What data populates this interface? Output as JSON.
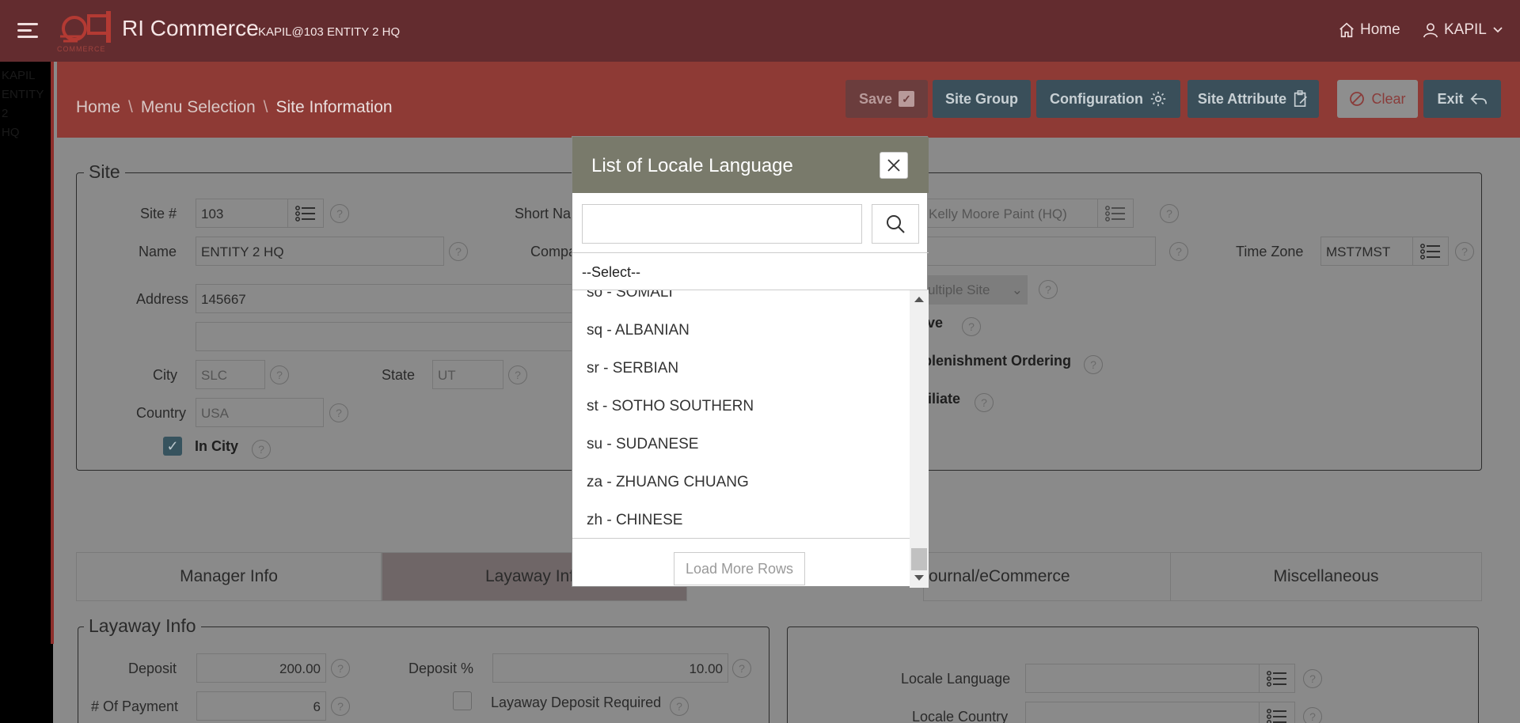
{
  "header": {
    "app_title": "RI Commerce",
    "app_subtitle": "KAPIL@103 ENTITY 2 HQ",
    "logo_text": "COMMERCE",
    "home_label": "Home",
    "user_label": "KAPIL"
  },
  "left_strip_ghost": [
    "KAPIL",
    "ENTITY",
    "2",
    "HQ"
  ],
  "breadcrumb": {
    "items": [
      "Home",
      "Menu Selection",
      "Site Information"
    ],
    "separator": "\\"
  },
  "toolbar": {
    "save": "Save",
    "site_group": "Site Group",
    "configuration": "Configuration",
    "site_attribute": "Site Attribute",
    "clear": "Clear",
    "exit": "Exit"
  },
  "site": {
    "legend": "Site",
    "site_no_label": "Site #",
    "site_no": "103",
    "short_name_label": "Short Na",
    "company_value": "Kelly Moore Paint (HQ)",
    "name_label": "Name",
    "name": "ENTITY 2 HQ",
    "company_label": "Compa",
    "time_zone_label": "Time Zone",
    "time_zone": "MST7MST",
    "address_label": "Address",
    "address1": "145667",
    "address2": "",
    "multiple_site": "ultiple Site",
    "city_label": "City",
    "city": "SLC",
    "state_label": "State",
    "state": "UT",
    "country_label": "Country",
    "country": "USA",
    "in_city_label": "In City",
    "active_label": "ive",
    "replenishment_label": "plenishment Ordering",
    "affiliate_label": "filiate"
  },
  "tabs": [
    "Manager Info",
    "Layaway Inf",
    "ournal/eCommerce",
    "Miscellaneous"
  ],
  "layaway": {
    "legend": "Layaway Info",
    "deposit_label": "Deposit",
    "deposit": "200.00",
    "deposit_pct_label": "Deposit %",
    "deposit_pct": "10.00",
    "payments_label": "# Of Payment",
    "payments": "6",
    "deposit_required_label": "Layaway Deposit Required"
  },
  "locale": {
    "language_label": "Locale Language",
    "country_label": "Locale Country"
  },
  "modal": {
    "title": "List of Locale Language",
    "search_placeholder": "",
    "select_label": "--Select--",
    "items": [
      "so - SOMALI",
      "sq - ALBANIAN",
      "sr - SERBIAN",
      "st - SOTHO SOUTHERN",
      "su - SUDANESE",
      "za - ZHUANG CHUANG",
      "zh - CHINESE"
    ],
    "load_more": "Load More Rows"
  },
  "colors": {
    "topbar": "#632c2f",
    "crumbbar": "#8e3a35",
    "button_dark": "#3a4f5a",
    "modal_header": "#797a6b"
  }
}
